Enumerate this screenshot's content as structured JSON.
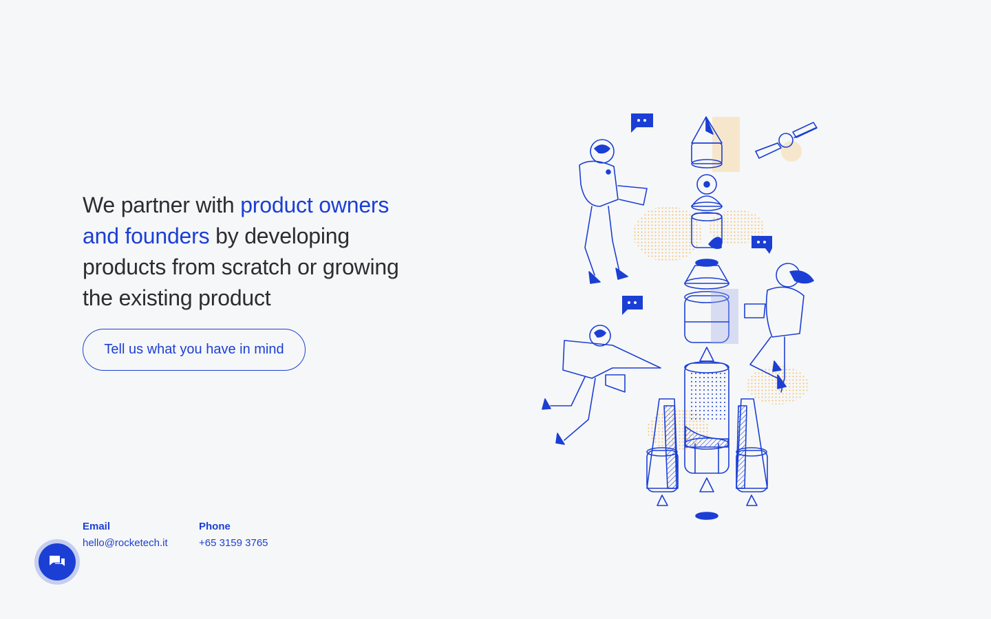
{
  "hero": {
    "headline_part1": "We partner with ",
    "headline_accent": "product owners and founders",
    "headline_part2": " by developing products from scratch or growing the existing product",
    "cta_label": "Tell us what you have in mind"
  },
  "contacts": {
    "email_label": "Email",
    "email_value": "hello@rocketech.it",
    "phone_label": "Phone",
    "phone_value": "+65 3159 3765"
  },
  "icons": {
    "chat": "chat-bubbles-icon",
    "illustration": "rocket-astronauts-illustration"
  },
  "colors": {
    "accent": "#1b3fd4",
    "text": "#2b2d33",
    "background": "#f6f7f8",
    "highlight": "#f5c87a"
  }
}
